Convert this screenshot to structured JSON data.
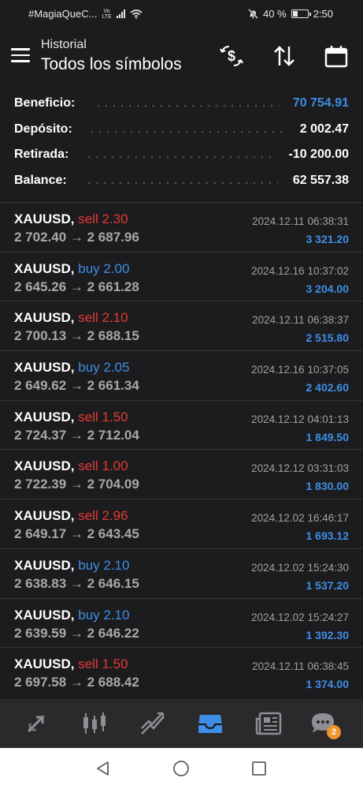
{
  "status_bar": {
    "carrier": "#MagiaQueC...",
    "network": "Vo LTE",
    "battery": "40 %",
    "battery_level": 0.4,
    "time": "2:50"
  },
  "header": {
    "subtitle": "Historial",
    "title": "Todos los símbolos"
  },
  "summary": {
    "profit_label": "Beneficio:",
    "profit_value": "70 754.91",
    "deposit_label": "Depósito:",
    "deposit_value": "2 002.47",
    "withdrawal_label": "Retirada:",
    "withdrawal_value": "-10 200.00",
    "balance_label": "Balance:",
    "balance_value": "62 557.38"
  },
  "deals": [
    {
      "symbol": "XAUUSD,",
      "side": "sell 2.30",
      "type": "sell",
      "prices": "2 702.40 → 2 687.96",
      "time": "2024.12.11 06:38:31",
      "profit": "3 321.20"
    },
    {
      "symbol": "XAUUSD,",
      "side": "buy 2.00",
      "type": "buy",
      "prices": "2 645.26 → 2 661.28",
      "time": "2024.12.16 10:37:02",
      "profit": "3 204.00"
    },
    {
      "symbol": "XAUUSD,",
      "side": "sell 2.10",
      "type": "sell",
      "prices": "2 700.13 → 2 688.15",
      "time": "2024.12.11 06:38:37",
      "profit": "2 515.80"
    },
    {
      "symbol": "XAUUSD,",
      "side": "buy 2.05",
      "type": "buy",
      "prices": "2 649.62 → 2 661.34",
      "time": "2024.12.16 10:37:05",
      "profit": "2 402.60"
    },
    {
      "symbol": "XAUUSD,",
      "side": "sell 1.50",
      "type": "sell",
      "prices": "2 724.37 → 2 712.04",
      "time": "2024.12.12 04:01:13",
      "profit": "1 849.50"
    },
    {
      "symbol": "XAUUSD,",
      "side": "sell 1.00",
      "type": "sell",
      "prices": "2 722.39 → 2 704.09",
      "time": "2024.12.12 03:31:03",
      "profit": "1 830.00"
    },
    {
      "symbol": "XAUUSD,",
      "side": "sell 2.96",
      "type": "sell",
      "prices": "2 649.17 → 2 643.45",
      "time": "2024.12.02 16:46:17",
      "profit": "1 693.12"
    },
    {
      "symbol": "XAUUSD,",
      "side": "buy 2.10",
      "type": "buy",
      "prices": "2 638.83 → 2 646.15",
      "time": "2024.12.02 15:24:30",
      "profit": "1 537.20"
    },
    {
      "symbol": "XAUUSD,",
      "side": "buy 2.10",
      "type": "buy",
      "prices": "2 639.59 → 2 646.22",
      "time": "2024.12.02 15:24:27",
      "profit": "1 392.30"
    },
    {
      "symbol": "XAUUSD,",
      "side": "sell 1.50",
      "type": "sell",
      "prices": "2 697.58 → 2 688.42",
      "time": "2024.12.11 06:38:45",
      "profit": "1 374.00"
    }
  ],
  "tabbar": {
    "tabs": [
      "quotes-icon",
      "chart-icon",
      "trade-icon",
      "history-icon",
      "news-icon",
      "chat-icon"
    ],
    "active": "history-icon",
    "chat_badge": "2"
  },
  "colors": {
    "background": "#1c1c1e",
    "sell": "#e53935",
    "buy": "#3e8ee6",
    "profit": "#3e8ee6",
    "badge": "#f0932b"
  }
}
